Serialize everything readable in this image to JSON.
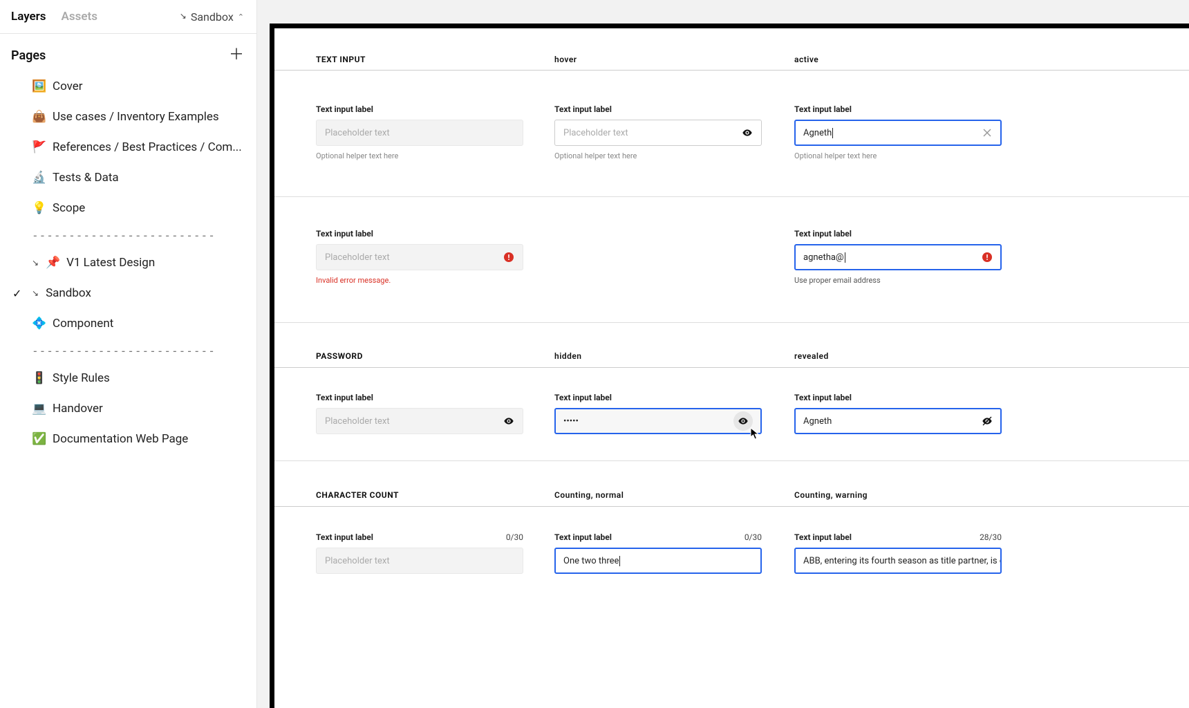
{
  "sidebar": {
    "tabs": {
      "layers": "Layers",
      "assets": "Assets"
    },
    "title_select": "Sandbox",
    "pages_header": "Pages",
    "pages": [
      {
        "emoji": "🖼️",
        "label": "Cover"
      },
      {
        "emoji": "👜",
        "label": "Use cases / Inventory Examples"
      },
      {
        "emoji": "🚩",
        "label": "References  / Best Practices / Com..."
      },
      {
        "emoji": "🔬",
        "label": "Tests & Data"
      },
      {
        "emoji": "💡",
        "label": "Scope"
      },
      {
        "divider": "-------------------------"
      },
      {
        "arrow": true,
        "emoji": "📌",
        "label": "V1  Latest Design"
      },
      {
        "arrow": true,
        "checked": true,
        "label": "Sandbox"
      },
      {
        "emoji": "💠",
        "label": "Component"
      },
      {
        "divider": "-------------------------"
      },
      {
        "emoji": "🚦",
        "label": "Style Rules"
      },
      {
        "emoji": "💻",
        "label": "Handover"
      },
      {
        "emoji": "✅",
        "label": "Documentation Web Page"
      }
    ]
  },
  "canvas": {
    "sections": {
      "text_input": {
        "header": "TEXT INPUT",
        "col2": "hover",
        "col3": "active"
      },
      "password": {
        "header": "PASSWORD",
        "col2": "hidden",
        "col3": "revealed"
      },
      "charcount": {
        "header": "CHARACTER COUNT",
        "col2": "Counting, normal",
        "col3": "Counting, warning"
      }
    },
    "fields": {
      "label": "Text input label",
      "placeholder": "Placeholder text",
      "helper": "Optional helper text here",
      "error_msg": "Invalid error message.",
      "r1c3_value": "Agneth",
      "r2c3_value": "agnetha@",
      "r2c3_helper": "Use proper email address",
      "pw_hidden": "•••••",
      "pw_revealed": "Agneth",
      "cc_r1_count": "0/30",
      "cc_r2_count": "0/30",
      "cc_r3_count": "28/30",
      "cc_r2_value": "One two three",
      "cc_r3_value": "ABB, entering its fourth season as title partner, is conti"
    }
  }
}
